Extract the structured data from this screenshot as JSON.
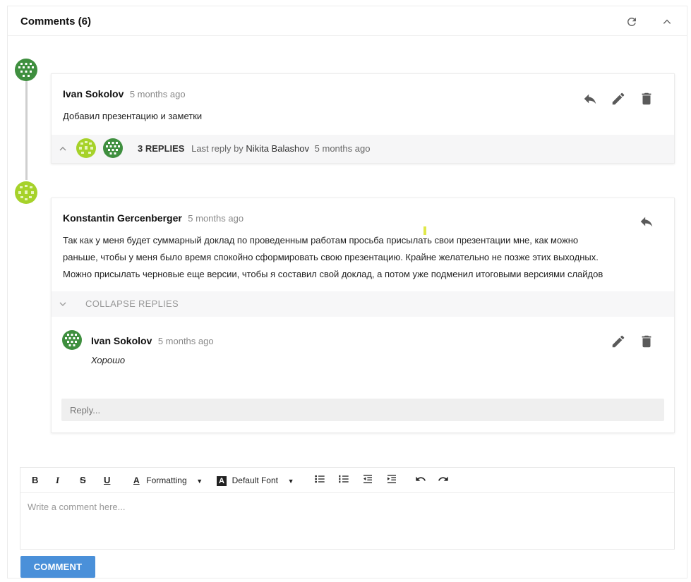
{
  "header": {
    "title": "Comments (6)",
    "refresh_icon": "refresh-icon",
    "collapse_icon": "chevron-up-icon"
  },
  "colors": {
    "accent": "#4a90d9",
    "avatar_green": "#3f8f3f",
    "avatar_lime": "#a6d22a"
  },
  "comments": [
    {
      "author": "Ivan Sokolov",
      "time": "5 months ago",
      "text": "Добавил презентацию и заметки",
      "actions": [
        "reply-icon",
        "edit-icon",
        "delete-icon"
      ],
      "replies_summary": {
        "count": "3 REPLIES",
        "last_reply_prefix": "Last reply by",
        "last_reply_author": "Nikita Balashov",
        "last_reply_time": "5 months ago"
      }
    },
    {
      "author": "Konstantin Gercenberger",
      "time": "5 months ago",
      "text_lines": [
        "Так как у меня будет суммарный доклад по проведенным работам просьба присылать свои презентации мне, как можно",
        "раньше, чтобы у меня было время спокойно сформировать свою презентацию. Крайне желательно не позже этих выходных.",
        "Можно присылать черновые еще версии, чтобы я составил свой доклад, а потом уже подменил итоговыми версиями слайдов"
      ],
      "actions": [
        "reply-icon"
      ],
      "collapse_label": "COLLAPSE REPLIES",
      "replies": [
        {
          "author": "Ivan Sokolov",
          "time": "5 months ago",
          "text": "Хорошо",
          "actions": [
            "edit-icon",
            "delete-icon"
          ]
        }
      ],
      "reply_placeholder": "Reply..."
    }
  ],
  "editor": {
    "toolbar": {
      "bold": "B",
      "italic": "I",
      "strike": "S",
      "underline": "U",
      "formatting": "Formatting",
      "font": "Default Font"
    },
    "placeholder": "Write a comment here..."
  },
  "submit_label": "COMMENT"
}
